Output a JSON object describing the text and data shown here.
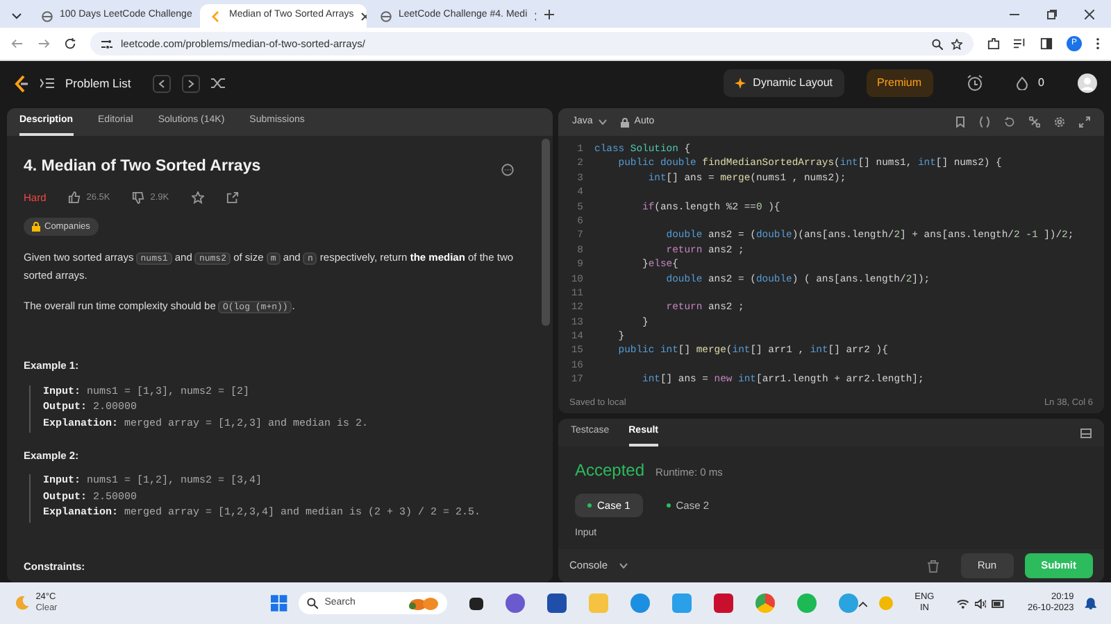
{
  "browser": {
    "tabs": [
      {
        "title": "100 Days LeetCode Challenge",
        "selected": false
      },
      {
        "title": "Median of Two Sorted Arrays",
        "selected": true
      },
      {
        "title": "LeetCode Challenge #4. Medi",
        "selected": false
      }
    ],
    "url": "leetcode.com/problems/median-of-two-sorted-arrays/",
    "profile_initial": "P"
  },
  "navbar": {
    "problem_list": "Problem List",
    "dynamic_layout": "Dynamic Layout",
    "premium": "Premium",
    "streak": "0"
  },
  "problem": {
    "tabs": [
      {
        "label": "Description",
        "selected": true
      },
      {
        "label": "Editorial",
        "selected": false
      },
      {
        "label": "Solutions (14K)",
        "selected": false
      },
      {
        "label": "Submissions",
        "selected": false
      }
    ],
    "title": "4. Median of Two Sorted Arrays",
    "difficulty": "Hard",
    "likes": "26.5K",
    "dislikes": "2.9K",
    "companies": "Companies",
    "paragraphs": [
      [
        {
          "kind": "text",
          "text": "Given two sorted arrays "
        },
        {
          "kind": "code",
          "text": "nums1"
        },
        {
          "kind": "text",
          "text": " and "
        },
        {
          "kind": "code",
          "text": "nums2"
        },
        {
          "kind": "text",
          "text": " of size "
        },
        {
          "kind": "code",
          "text": "m"
        },
        {
          "kind": "text",
          "text": " and "
        },
        {
          "kind": "code",
          "text": "n"
        },
        {
          "kind": "text",
          "text": " respectively, return "
        },
        {
          "kind": "bold",
          "text": "the median"
        },
        {
          "kind": "text",
          "text": " of the two sorted arrays."
        }
      ],
      [
        {
          "kind": "text",
          "text": "The overall run time complexity should be "
        },
        {
          "kind": "code",
          "text": "O(log (m+n))"
        },
        {
          "kind": "text",
          "text": "."
        }
      ]
    ],
    "examples": [
      {
        "heading": "Example 1:",
        "lines": [
          "**Input:** nums1 = [1,3], nums2 = [2]",
          "**Output:** 2.00000",
          "**Explanation:** merged array = [1,2,3] and median is 2."
        ]
      },
      {
        "heading": "Example 2:",
        "lines": [
          "**Input:** nums1 = [1,2], nums2 = [3,4]",
          "**Output:** 2.50000",
          "**Explanation:** merged array = [1,2,3,4] and median is (2 + 3) / 2 = 2.5."
        ]
      }
    ],
    "constraints_heading": "Constraints:"
  },
  "editor": {
    "language": "Java",
    "mode": "Auto",
    "lines": [
      {
        "number": "1",
        "tokens": [
          {
            "kind": "kw",
            "text": "class"
          },
          {
            "kind": "type",
            "text": " Solution"
          },
          {
            "kind": "p",
            "text": " {"
          }
        ]
      },
      {
        "number": "2",
        "tokens": [
          {
            "kind": "kw",
            "text": "    public double"
          },
          {
            "kind": "fn",
            "text": " findMedianSortedArrays"
          },
          {
            "kind": "p",
            "text": "("
          },
          {
            "kind": "kw",
            "text": "int"
          },
          {
            "kind": "p",
            "text": "[] nums1, "
          },
          {
            "kind": "kw",
            "text": "int"
          },
          {
            "kind": "p",
            "text": "[] nums2) {"
          }
        ]
      },
      {
        "number": "3",
        "tokens": [
          {
            "kind": "kw",
            "text": "         int"
          },
          {
            "kind": "p",
            "text": "[] ans = "
          },
          {
            "kind": "fn",
            "text": "merge"
          },
          {
            "kind": "p",
            "text": "(nums1 , nums2);"
          }
        ]
      },
      {
        "number": "4"
      },
      {
        "number": "5",
        "tokens": [
          {
            "kind": "ctl",
            "text": "        if"
          },
          {
            "kind": "p",
            "text": "(ans.length %2 =="
          },
          {
            "kind": "num",
            "text": "0"
          },
          {
            "kind": "p",
            "text": " ){"
          }
        ]
      },
      {
        "number": "6"
      },
      {
        "number": "7",
        "tokens": [
          {
            "kind": "kw",
            "text": "            double"
          },
          {
            "kind": "p",
            "text": " ans2 = ("
          },
          {
            "kind": "kw",
            "text": "double"
          },
          {
            "kind": "p",
            "text": ")(ans[ans.length/"
          },
          {
            "kind": "num",
            "text": "2"
          },
          {
            "kind": "p",
            "text": "] + ans[ans.length/"
          },
          {
            "kind": "num",
            "text": "2"
          },
          {
            "kind": "p",
            "text": " -"
          },
          {
            "kind": "num",
            "text": "1"
          },
          {
            "kind": "p",
            "text": " ])/"
          },
          {
            "kind": "num",
            "text": "2"
          },
          {
            "kind": "p",
            "text": ";"
          }
        ]
      },
      {
        "number": "8",
        "tokens": [
          {
            "kind": "ctl",
            "text": "            return"
          },
          {
            "kind": "p",
            "text": " ans2 ;"
          }
        ]
      },
      {
        "number": "9",
        "tokens": [
          {
            "kind": "p",
            "text": "        }"
          },
          {
            "kind": "ctl",
            "text": "else"
          },
          {
            "kind": "p",
            "text": "{"
          }
        ]
      },
      {
        "number": "10",
        "tokens": [
          {
            "kind": "kw",
            "text": "            double"
          },
          {
            "kind": "p",
            "text": " ans2 = ("
          },
          {
            "kind": "kw",
            "text": "double"
          },
          {
            "kind": "p",
            "text": ") ( ans[ans.length/"
          },
          {
            "kind": "num",
            "text": "2"
          },
          {
            "kind": "p",
            "text": "]);"
          }
        ]
      },
      {
        "number": "11"
      },
      {
        "number": "12",
        "tokens": [
          {
            "kind": "ctl",
            "text": "            return"
          },
          {
            "kind": "p",
            "text": " ans2 ;"
          }
        ]
      },
      {
        "number": "13",
        "tokens": [
          {
            "kind": "p",
            "text": "        }"
          }
        ]
      },
      {
        "number": "14",
        "tokens": [
          {
            "kind": "p",
            "text": "    }"
          }
        ]
      },
      {
        "number": "15",
        "tokens": [
          {
            "kind": "kw",
            "text": "    public int"
          },
          {
            "kind": "p",
            "text": "[] "
          },
          {
            "kind": "fn",
            "text": "merge"
          },
          {
            "kind": "p",
            "text": "("
          },
          {
            "kind": "kw",
            "text": "int"
          },
          {
            "kind": "p",
            "text": "[] arr1 , "
          },
          {
            "kind": "kw",
            "text": "int"
          },
          {
            "kind": "p",
            "text": "[] arr2 ){"
          }
        ]
      },
      {
        "number": "16"
      },
      {
        "number": "17",
        "tokens": [
          {
            "kind": "kw",
            "text": "        int"
          },
          {
            "kind": "p",
            "text": "[] ans = "
          },
          {
            "kind": "ctl",
            "text": "new"
          },
          {
            "kind": "kw",
            "text": " int"
          },
          {
            "kind": "p",
            "text": "[arr1.length + arr2.length];"
          }
        ]
      }
    ],
    "status": "Saved to local",
    "cursor": "Ln 38, Col 6"
  },
  "result": {
    "tabs": [
      {
        "label": "Testcase",
        "selected": false
      },
      {
        "label": "Result",
        "selected": true
      }
    ],
    "verdict": "Accepted",
    "runtime": "Runtime: 0 ms",
    "cases": [
      {
        "label": "Case 1",
        "selected": true
      },
      {
        "label": "Case 2",
        "selected": false
      }
    ],
    "input_label": "Input",
    "console": "Console",
    "run": "Run",
    "submit": "Submit"
  },
  "taskbar": {
    "temperature": "24°C",
    "weather": "Clear",
    "search_placeholder": "Search",
    "language": "ENG",
    "region": "IN",
    "time": "20:19",
    "date": "26-10-2023"
  }
}
